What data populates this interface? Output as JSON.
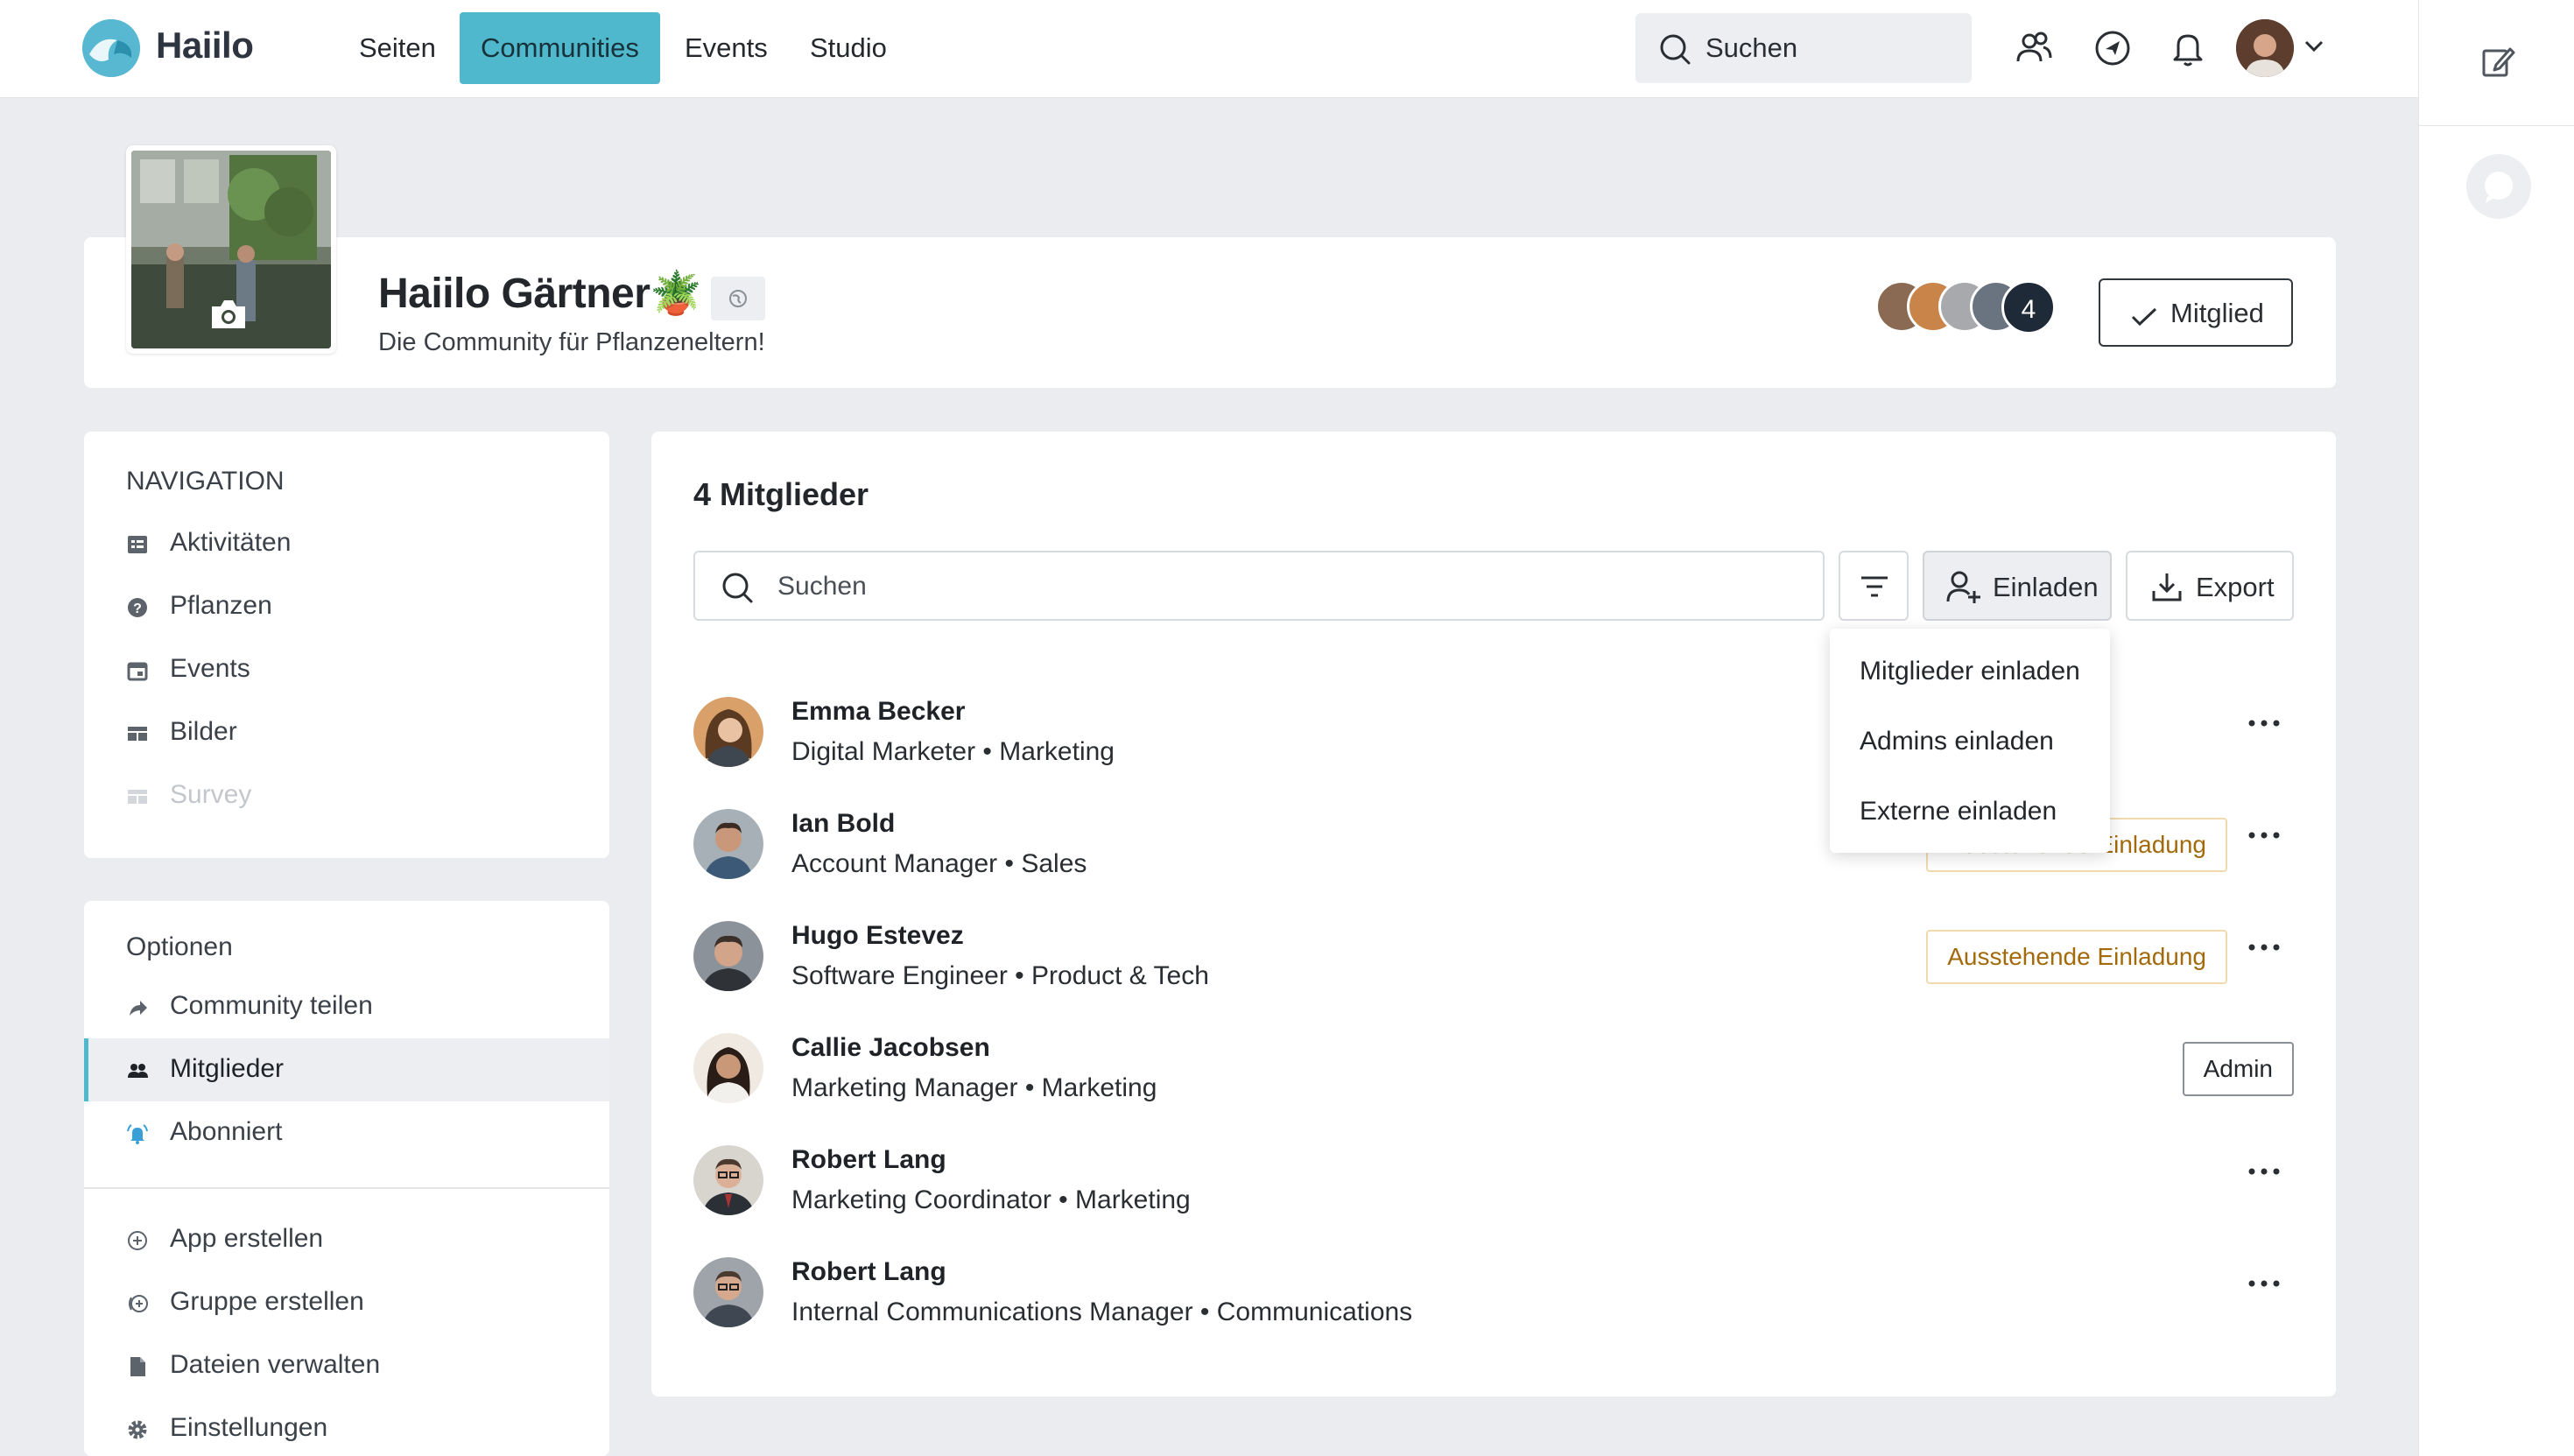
{
  "topbar": {
    "brand": "Haiilo",
    "nav": [
      "Seiten",
      "Communities",
      "Events",
      "Studio"
    ],
    "active_nav": "Communities",
    "search_placeholder": "Suchen"
  },
  "community": {
    "title": "Haiilo Gärtner🪴",
    "subtitle": "Die Community für Pflanzeneltern!",
    "member_count": "4",
    "member_button": "Mitglied"
  },
  "navigation": {
    "title": "NAVIGATION",
    "items": [
      {
        "label": "Aktivitäten",
        "icon": "activity-icon"
      },
      {
        "label": "Pflanzen",
        "icon": "help-icon"
      },
      {
        "label": "Events",
        "icon": "calendar-icon"
      },
      {
        "label": "Bilder",
        "icon": "gallery-icon"
      },
      {
        "label": "Survey",
        "icon": "gallery-icon"
      }
    ]
  },
  "options": {
    "title": "Optionen",
    "items": [
      {
        "label": "Community teilen",
        "icon": "share-icon"
      },
      {
        "label": "Mitglieder",
        "icon": "members-icon"
      },
      {
        "label": "Abonniert",
        "icon": "subscribe-icon"
      }
    ],
    "actions": [
      {
        "label": "App erstellen",
        "icon": "add-circle-icon"
      },
      {
        "label": "Gruppe erstellen",
        "icon": "add-group-icon"
      },
      {
        "label": "Dateien verwalten",
        "icon": "file-icon"
      },
      {
        "label": "Einstellungen",
        "icon": "gear-icon"
      }
    ]
  },
  "members": {
    "title": "4 Mitglieder",
    "search_placeholder": "Suchen",
    "invite_label": "Einladen",
    "export_label": "Export",
    "dropdown": [
      "Mitglieder einladen",
      "Admins einladen",
      "Externe einladen"
    ],
    "list": [
      {
        "name": "Emma Becker",
        "role": "Digital Marketer",
        "dept": "Marketing",
        "badge": ""
      },
      {
        "name": "Ian Bold",
        "role": "Account Manager",
        "dept": "Sales",
        "badge": "Ausstehende Einladung"
      },
      {
        "name": "Hugo Estevez",
        "role": "Software Engineer",
        "dept": "Product & Tech",
        "badge": "Ausstehende Einladung"
      },
      {
        "name": "Callie Jacobsen",
        "role": "Marketing Manager",
        "dept": "Marketing",
        "badge": "Admin"
      },
      {
        "name": "Robert Lang",
        "role": "Marketing Coordinator",
        "dept": "Marketing",
        "badge": ""
      },
      {
        "name": "Robert Lang",
        "role": "Internal Communications Manager",
        "dept": "Communications",
        "badge": ""
      }
    ],
    "separator": "•"
  },
  "colors": {
    "accent": "#50b8cc",
    "pending": "#a36a0b",
    "dark_badge": "#1f2a38"
  }
}
